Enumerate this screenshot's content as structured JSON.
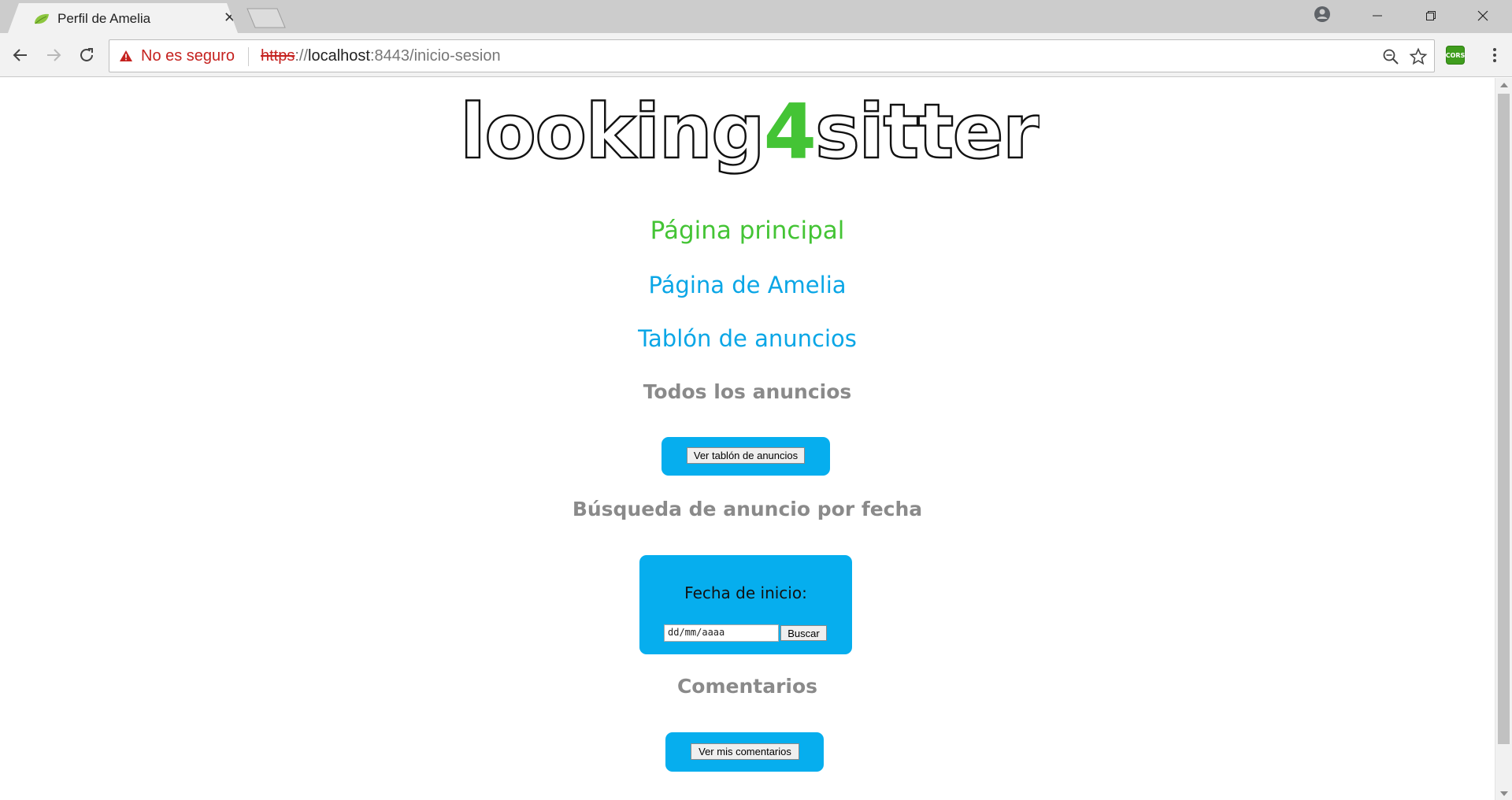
{
  "browser": {
    "tab": {
      "title": "Perfil de Amelia"
    },
    "address_bar": {
      "security_label": "No es seguro",
      "url_scheme": "https",
      "url_separator": "://",
      "url_host": "localhost",
      "url_rest": ":8443/inicio-sesion"
    },
    "extensions": {
      "cors_label": "CORS"
    }
  },
  "page": {
    "logo": {
      "part1": "looking",
      "part2": "4",
      "part3": "sitter"
    },
    "nav": {
      "main_link": "Página principal",
      "profile_link": "Página de Amelia",
      "board_link": "Tablón de anuncios"
    },
    "sections": {
      "all_ads": {
        "title": "Todos los anuncios",
        "button": "Ver tablón de anuncios"
      },
      "date_search": {
        "title": "Búsqueda de anuncio por fecha",
        "label": "Fecha de inicio:",
        "input_placeholder": "dd/mm/aaaa",
        "button": "Buscar"
      },
      "comments": {
        "title": "Comentarios",
        "button": "Ver mis comentarios"
      }
    }
  },
  "colors": {
    "accent_green": "#44c435",
    "link_blue": "#0aa6e6",
    "box_blue": "#06aeee",
    "subheading_gray": "#8a8a8a",
    "insecure_red": "#c5221f"
  }
}
